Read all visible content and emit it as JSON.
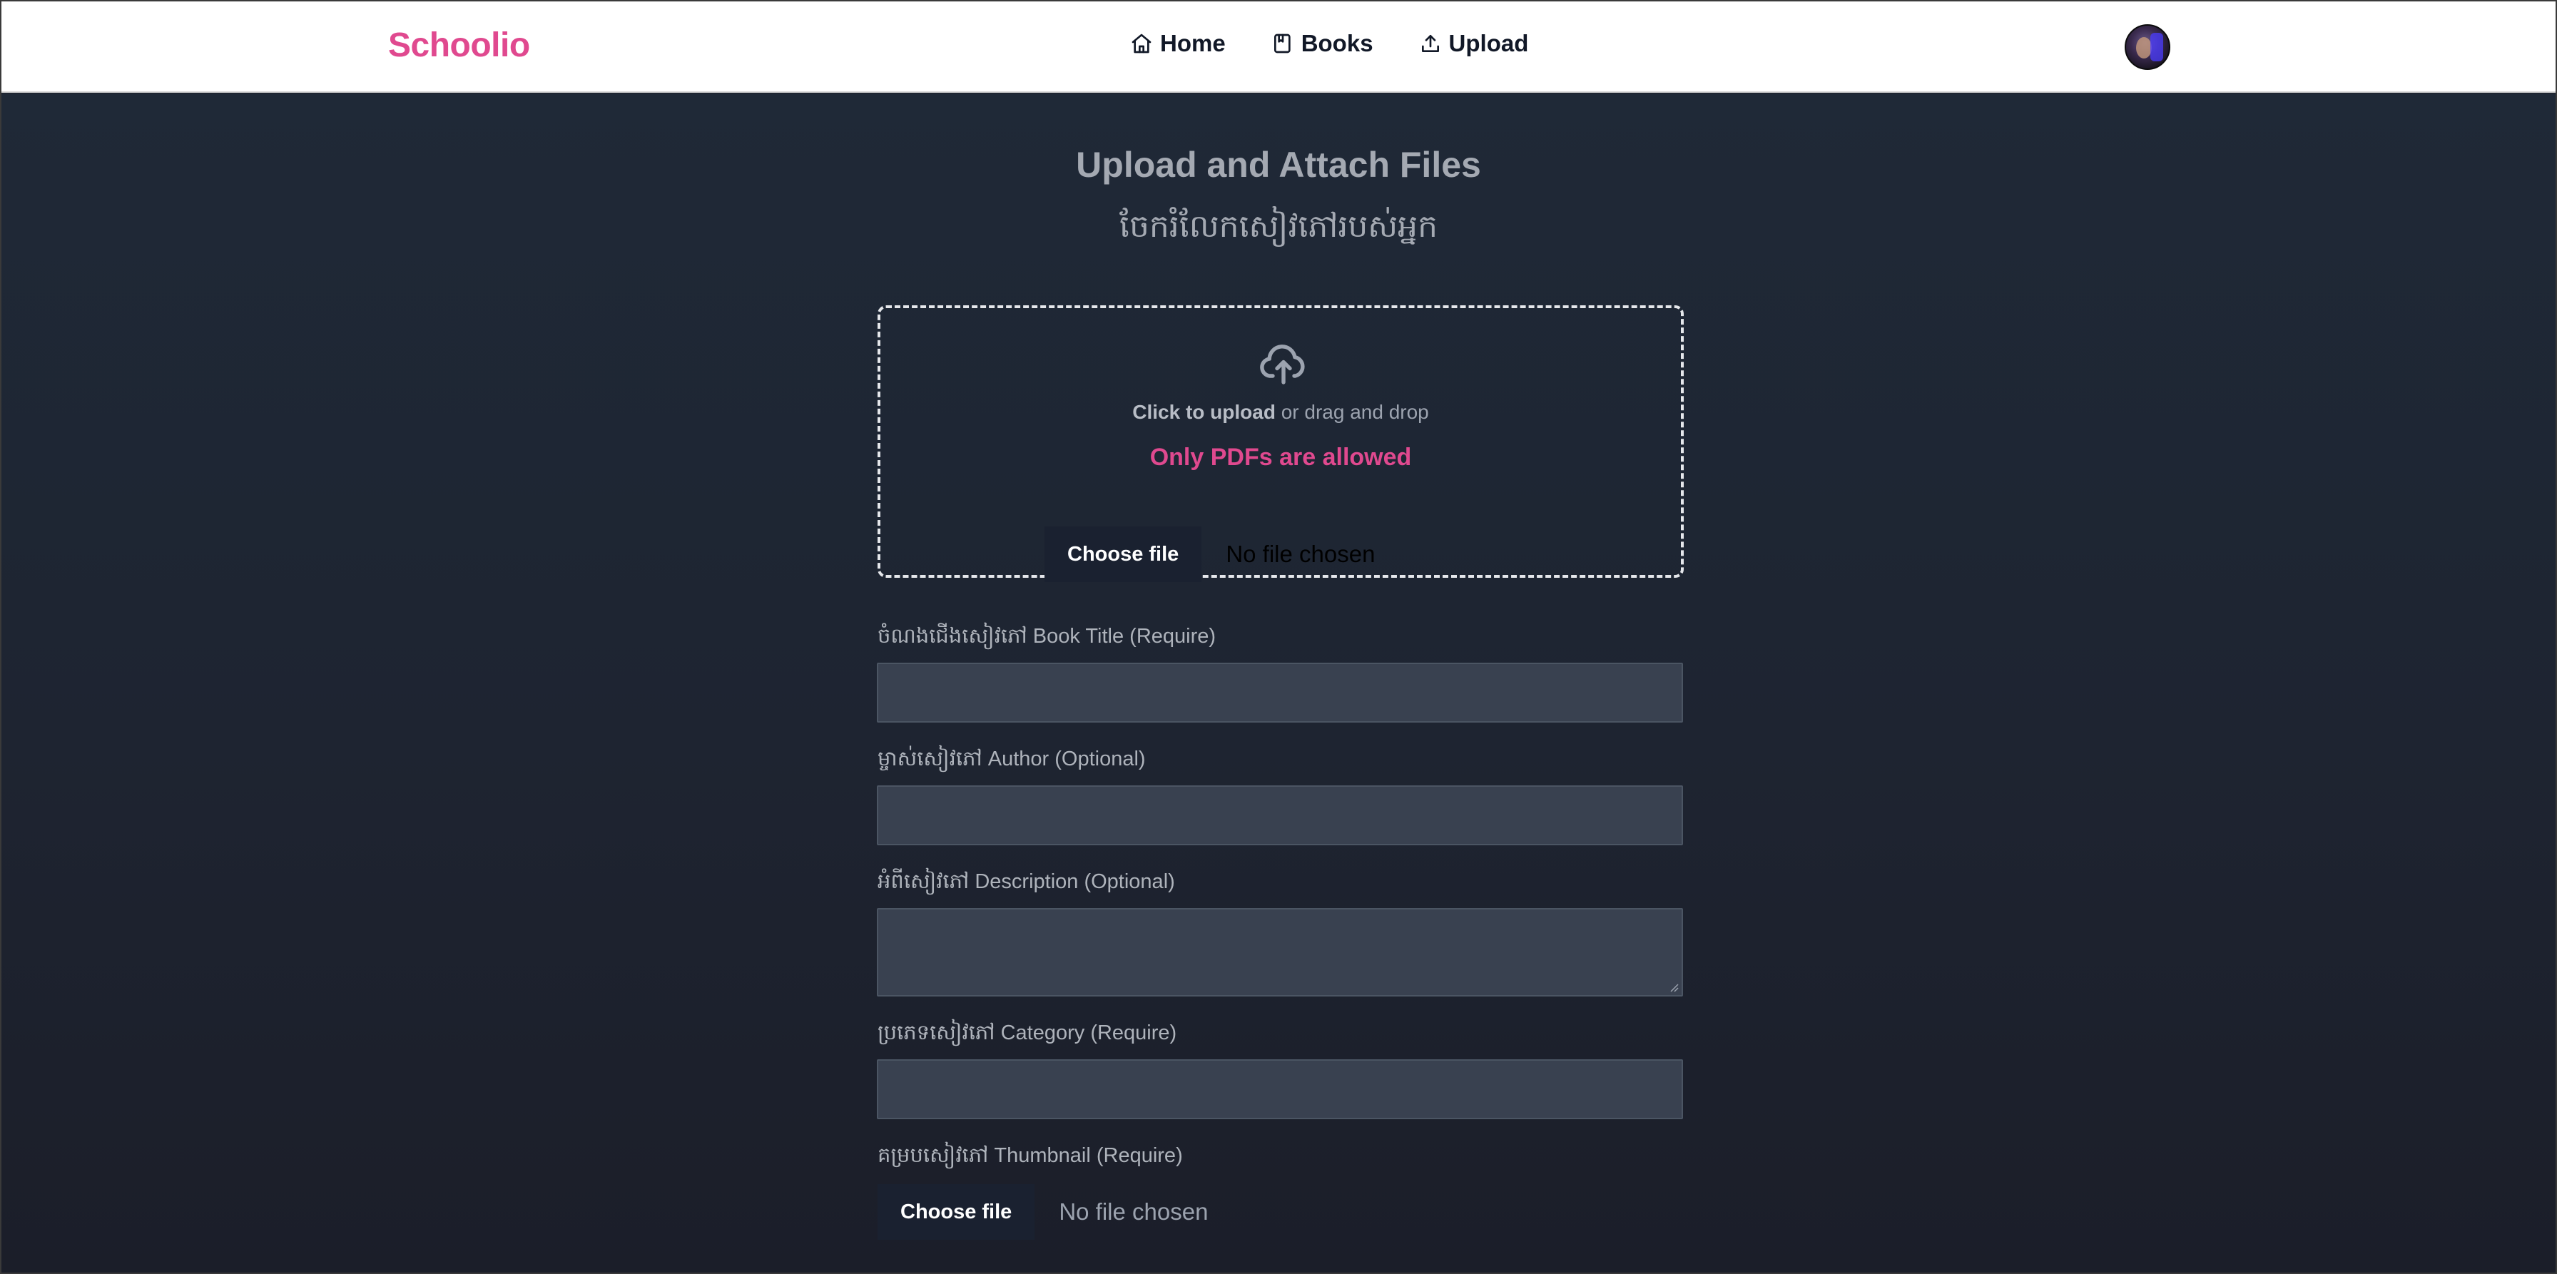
{
  "navbar": {
    "brand": "Schoolio",
    "links": [
      {
        "label": "Home",
        "icon": "home-icon"
      },
      {
        "label": "Books",
        "icon": "book-icon"
      },
      {
        "label": "Upload",
        "icon": "upload-icon"
      }
    ],
    "avatar_icon": "user-avatar"
  },
  "page": {
    "title": "Upload and Attach Files",
    "subtitle": "ចែករំលែកសៀវភៅរបស់អ្នក"
  },
  "dropzone": {
    "icon": "cloud-upload-icon",
    "click_text": "Click to upload",
    "rest_text": " or drag and drop",
    "warning": "Only PDFs are allowed",
    "choose_label": "Choose file",
    "status": "No file chosen"
  },
  "form": {
    "title_label": "ចំណងជើងសៀវភៅ Book Title (Require)",
    "title_value": "",
    "author_label": "ម្ចាស់សៀវភៅ Author (Optional)",
    "author_value": "",
    "description_label": "អំពីសៀវភៅ Description (Optional)",
    "description_value": "",
    "category_label": "ប្រភេទសៀវភៅ Category (Require)",
    "category_value": "",
    "thumbnail_label": "គម្របសៀវភៅ Thumbnail (Require)",
    "thumbnail_choose_label": "Choose file",
    "thumbnail_status": "No file chosen"
  },
  "colors": {
    "accent": "#e0498f",
    "navbar_bg": "#ffffff",
    "page_bg": "#1f2937",
    "input_bg": "#394150"
  }
}
